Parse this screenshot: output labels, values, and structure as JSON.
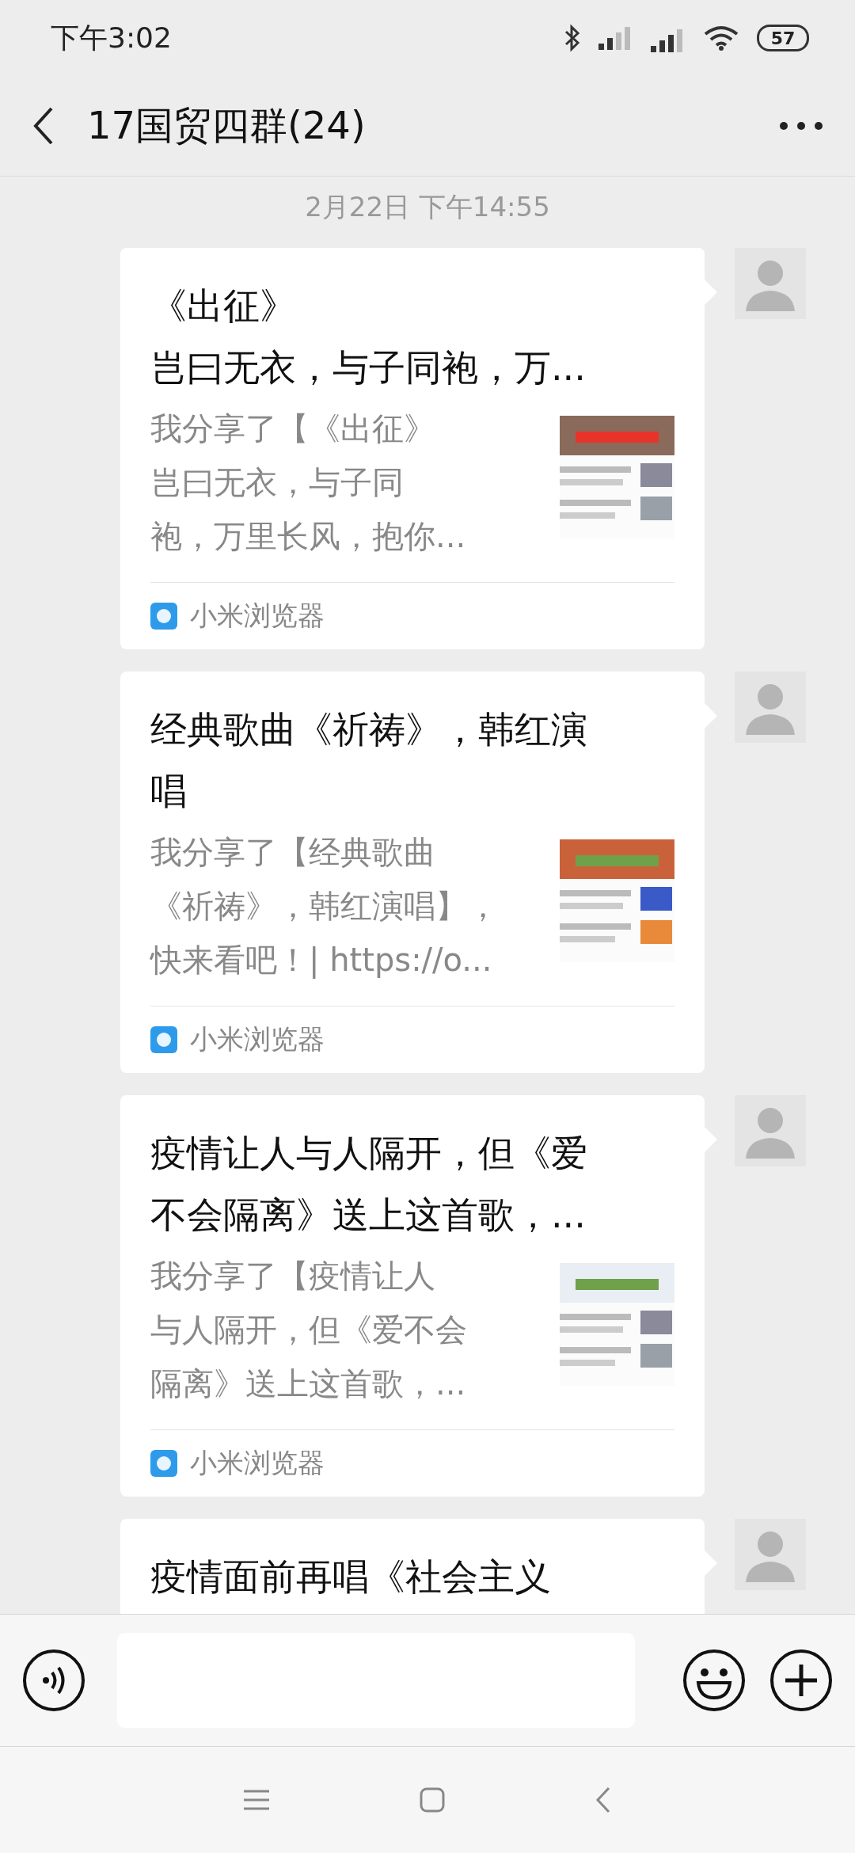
{
  "status_bar": {
    "time": "下午3:02",
    "battery": "57"
  },
  "header": {
    "title": "17国贸四群(24)"
  },
  "timestamp": "2月22日 下午14:55",
  "messages": [
    {
      "kind": "link_card",
      "title_lines": [
        "《出征》",
        "岂曰无衣，与子同袍，万..."
      ],
      "description_lines": [
        "我分享了【《出征》",
        "岂曰无衣，与子同",
        "袍，万里长风，抱你..."
      ],
      "thumbnail": {
        "kind": "picture"
      },
      "source": "小米浏览器"
    },
    {
      "kind": "link_card",
      "title_lines": [
        "经典歌曲《祈祷》，韩红演",
        "唱"
      ],
      "description_lines": [
        "我分享了【经典歌曲",
        "《祈祷》，韩红演唱】，",
        "快来看吧！| https://o..."
      ],
      "thumbnail": {
        "kind": "picture"
      },
      "source": "小米浏览器"
    },
    {
      "kind": "link_card",
      "title_lines": [
        "疫情让人与人隔开，但《爱",
        "不会隔离》送上这首歌，..."
      ],
      "description_lines": [
        "我分享了【疫情让人",
        "与人隔开，但《爱不会",
        "隔离》送上这首歌，..."
      ],
      "thumbnail": {
        "kind": "picture"
      },
      "source": "小米浏览器"
    },
    {
      "kind": "partial",
      "title_lines": [
        "疫情面前再唱《社会主义"
      ]
    }
  ]
}
